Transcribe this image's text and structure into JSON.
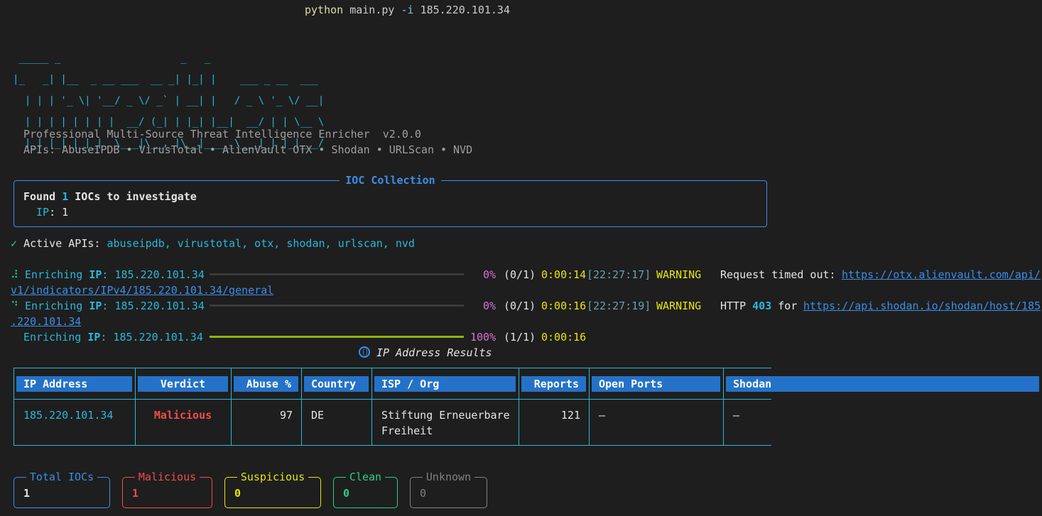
{
  "command": {
    "prog": "python",
    "args": "main.py",
    "flag": "-i",
    "ip": "185.220.101.34"
  },
  "banner": [
    " _____ _                    _   _",
    "|_   _| |__  _ __ ___  __ _| |_| |    ___ _ __  ___",
    "  | | | '_ \\| '__/ _ \\/ _` | __| |   / _ \\ '_ \\/ __|",
    "  | | | | | | | |  __/ (_| | |_| |__|  __/ | | \\__ \\",
    "  |_| |_| |_|_|  \\___|\\__,_|\\__|_____\\___|_| |_|___/"
  ],
  "subtitle": "Professional Multi-Source Threat Intelligence Enricher  v2.0.0",
  "apis_line": "APIs: AbuseIPDB • VirusTotal • AlienVault OTX • Shodan • URLScan • NVD",
  "ioc_panel": {
    "title": "IOC Collection",
    "found_prefix": "Found ",
    "found_count": "1",
    "found_suffix": " IOCs to investigate",
    "type_label": "IP",
    "type_count": ": 1"
  },
  "active_apis": {
    "check": "✓",
    "label": "Active APIs: ",
    "list": "abuseipdb, virustotal, otx, shodan, urlscan, nvd"
  },
  "progress": [
    {
      "spinner": "⠼",
      "prefix": "Enriching ",
      "type": "IP",
      "ip": ": 185.220.101.34",
      "fill": 0.0,
      "pct": "0%",
      "count": "(0/1)",
      "elapsed": "0:00:14",
      "time": "[22:27:17]",
      "level": "WARNING",
      "msg": "Request timed out: ",
      "url": "https://otx.alienvault.com/api/",
      "url_cont": "v1/indicators/IPv4/185.220.101.34/general"
    },
    {
      "spinner": "⠙",
      "prefix": "Enriching ",
      "type": "IP",
      "ip": ": 185.220.101.34",
      "fill": 0.0,
      "pct": "0%",
      "count": "(0/1)",
      "elapsed": "0:00:16",
      "time": "[22:27:19]",
      "level": "WARNING",
      "msg_a": "HTTP ",
      "code": "403",
      "msg_b": " for ",
      "url": "https://api.shodan.io/shodan/host/185",
      "url_cont": ".220.101.34"
    },
    {
      "prefix": "Enriching ",
      "type": "IP",
      "ip": ": 185.220.101.34",
      "fill": 1.0,
      "pct": "100%",
      "count": "(1/1)",
      "elapsed": "0:00:16"
    }
  ],
  "results": {
    "title": "IP Address Results",
    "headers": [
      "IP Address",
      "Verdict",
      "Abuse %",
      "Country",
      "ISP / Org",
      "Reports",
      "Open Ports",
      "Shodan"
    ],
    "row": {
      "ip": "185.220.101.34",
      "verdict": "Malicious",
      "abuse": "97",
      "country": "DE",
      "isp_1": "Stiftung Erneuerbare",
      "isp_2": "Freiheit",
      "reports": "121",
      "ports": "–",
      "shodan": "–"
    }
  },
  "stats": [
    {
      "label": "Total IOCs",
      "value": "1",
      "color": "#3b8eea"
    },
    {
      "label": "Malicious",
      "value": "1",
      "color": "#f14c4c"
    },
    {
      "label": "Suspicious",
      "value": "0",
      "color": "#e5e510"
    },
    {
      "label": "Clean",
      "value": "0",
      "color": "#23d18b"
    },
    {
      "label": "Unknown",
      "value": "0",
      "color": "#808080"
    }
  ],
  "colors": {
    "accent": "#3b8eea",
    "cyan": "#29b8db",
    "background": "#1e1e1e"
  }
}
